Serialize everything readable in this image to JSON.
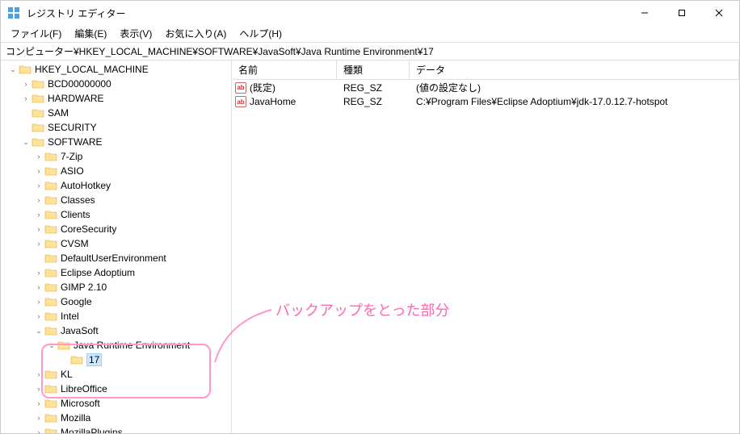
{
  "window": {
    "title": "レジストリ エディター"
  },
  "menu": {
    "file": "ファイル(F)",
    "edit": "編集(E)",
    "view": "表示(V)",
    "favorites": "お気に入り(A)",
    "help": "ヘルプ(H)"
  },
  "address": {
    "path": "コンピューター¥HKEY_LOCAL_MACHINE¥SOFTWARE¥JavaSoft¥Java Runtime Environment¥17"
  },
  "tree": {
    "root": "HKEY_LOCAL_MACHINE",
    "items": [
      "BCD00000000",
      "HARDWARE",
      "SAM",
      "SECURITY",
      "SOFTWARE",
      "7-Zip",
      "ASIO",
      "AutoHotkey",
      "Classes",
      "Clients",
      "CoreSecurity",
      "CVSM",
      "DefaultUserEnvironment",
      "Eclipse Adoptium",
      "GIMP 2.10",
      "Google",
      "Intel",
      "JavaSoft",
      "Java Runtime Environment",
      "17",
      "KL",
      "LibreOffice",
      "Microsoft",
      "Mozilla",
      "MozillaPlugins"
    ]
  },
  "list": {
    "cols": {
      "name": "名前",
      "type": "種類",
      "data": "データ"
    },
    "rows": [
      {
        "icon": "ab",
        "name": "(既定)",
        "type": "REG_SZ",
        "data": "(値の設定なし)"
      },
      {
        "icon": "ab",
        "name": "JavaHome",
        "type": "REG_SZ",
        "data": "C:¥Program Files¥Eclipse Adoptium¥jdk-17.0.12.7-hotspot"
      }
    ]
  },
  "annotation": {
    "text": "バックアップをとった部分"
  }
}
